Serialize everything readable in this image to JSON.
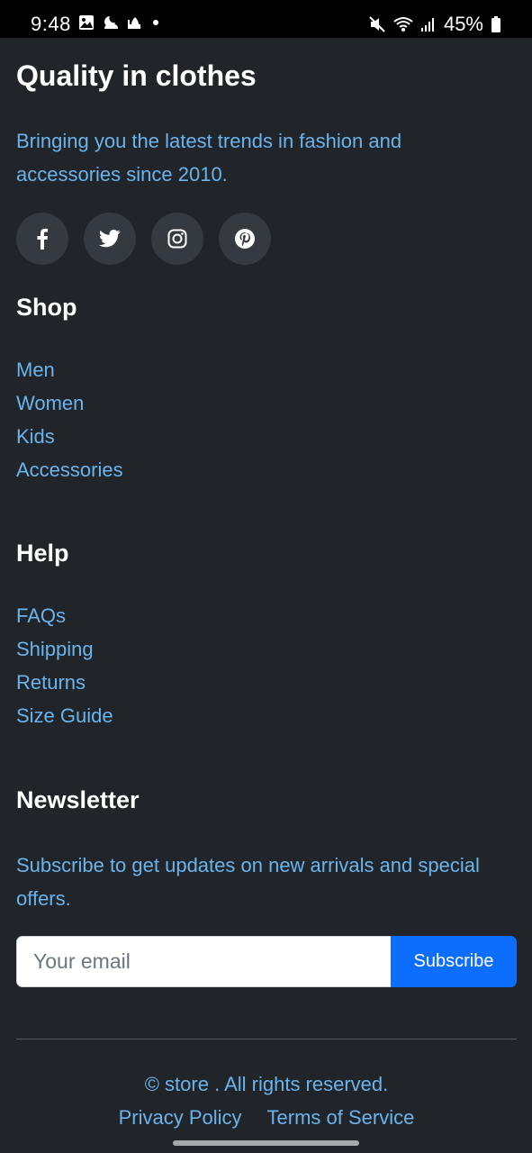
{
  "status_bar": {
    "time": "9:48",
    "battery": "45%",
    "left_icons": [
      "gallery-icon",
      "cloud-moon-icon",
      "mosque-icon",
      "dot-icon"
    ],
    "right_icons": [
      "mute-icon",
      "wifi-icon",
      "signal-icon",
      "battery-icon"
    ]
  },
  "brand": {
    "title": "Quality in clothes",
    "tagline": "Bringing you the latest trends in fashion and accessories since 2010."
  },
  "socials": [
    "facebook-icon",
    "twitter-icon",
    "instagram-icon",
    "pinterest-icon"
  ],
  "shop": {
    "title": "Shop",
    "links": [
      "Men",
      "Women",
      "Kids",
      "Accessories"
    ]
  },
  "help": {
    "title": "Help",
    "links": [
      "FAQs",
      "Shipping",
      "Returns",
      "Size Guide"
    ]
  },
  "newsletter": {
    "title": "Newsletter",
    "description": "Subscribe to get updates on new arrivals and special offers.",
    "email_placeholder": "Your email",
    "email_value": "",
    "subscribe_label": "Subscribe"
  },
  "footer": {
    "copyright": "© store . All rights reserved.",
    "privacy": "Privacy Policy",
    "terms": "Terms of Service"
  },
  "colors": {
    "background": "#212529",
    "link": "#6ab4ee",
    "primary_button": "#0d6efd",
    "social_button": "#343a40"
  }
}
